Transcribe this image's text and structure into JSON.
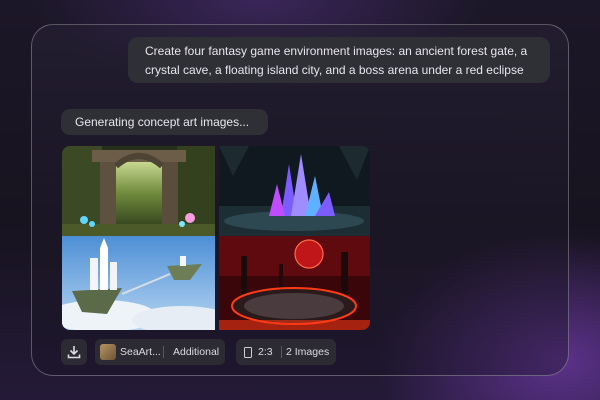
{
  "chat": {
    "user_prompt_line1": "Create four fantasy game environment images: an ancient forest gate, a",
    "user_prompt_line2": "crystal cave, a floating island city, and a boss arena under a red eclipse",
    "status": "Generating concept art images..."
  },
  "images": [
    {
      "subject": "ancient forest gate",
      "icon": "forest-gate-image"
    },
    {
      "subject": "crystal cave",
      "icon": "crystal-cave-image"
    },
    {
      "subject": "floating island city",
      "icon": "floating-island-image"
    },
    {
      "subject": "boss arena under a red eclipse",
      "icon": "red-eclipse-arena-image"
    }
  ],
  "toolbar": {
    "download_icon": "download-icon",
    "model_name": "SeaArt...",
    "model_extra": "Additional",
    "aspect_ratio": "2:3",
    "image_count": "2 Images"
  },
  "colors": {
    "bubble": "#2f2f36",
    "accent_purple": "#8c46d2",
    "eclipse_red": "#c0161a"
  }
}
